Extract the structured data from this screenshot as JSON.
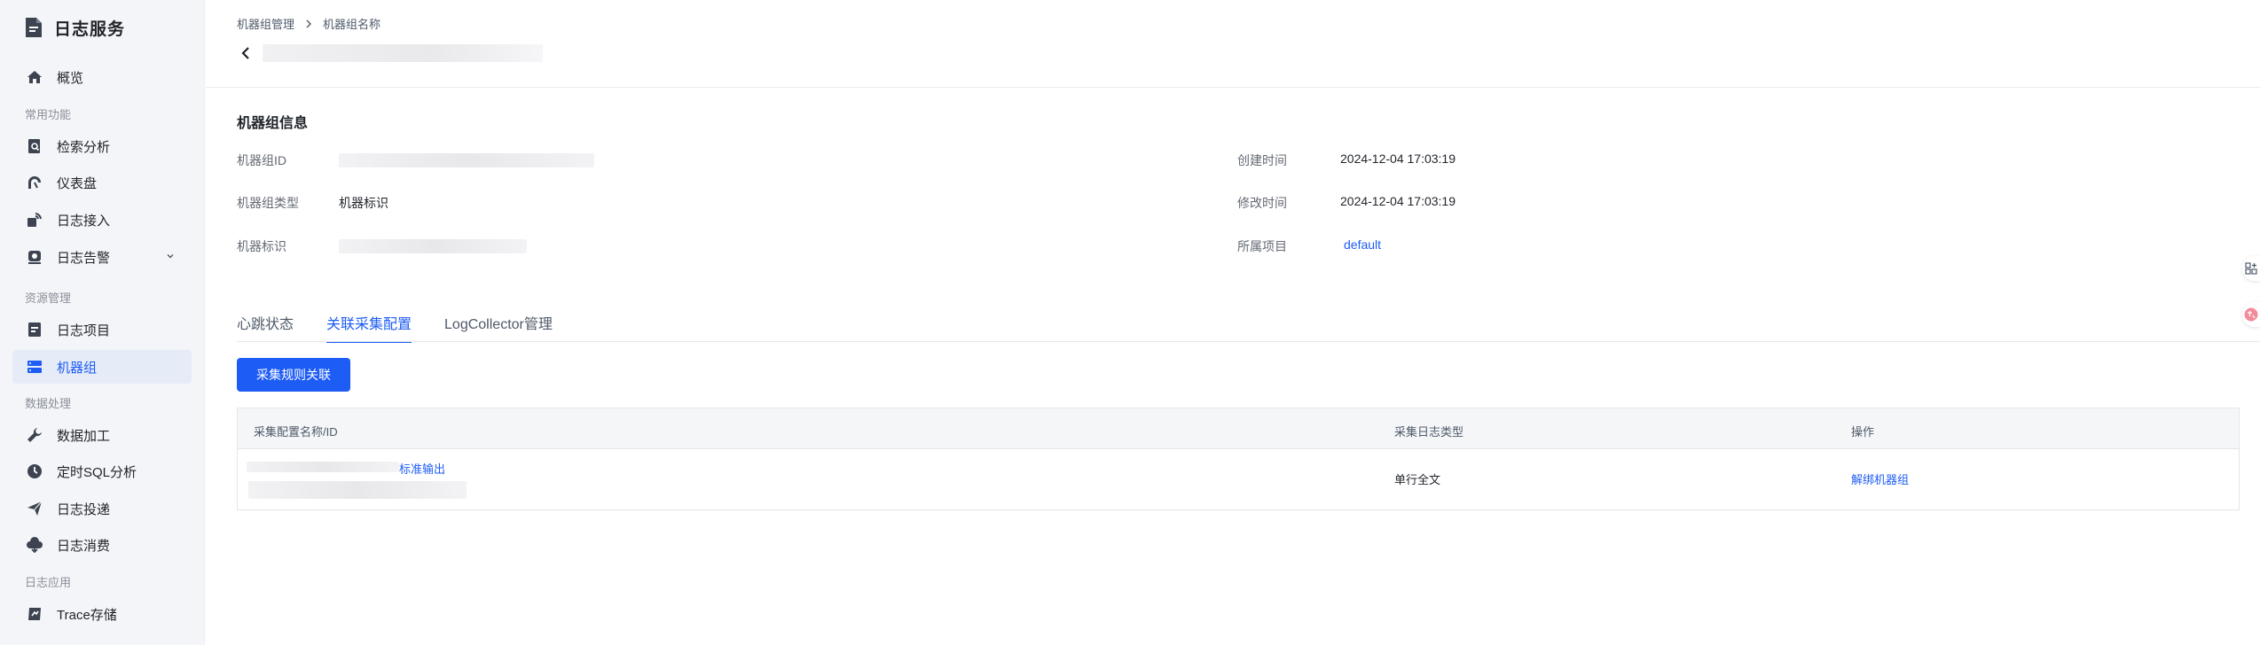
{
  "app": {
    "title": "日志服务"
  },
  "sidebar": {
    "overview": {
      "label": "概览",
      "icon": "home-icon"
    },
    "sections": {
      "common": "常用功能",
      "resources": "资源管理",
      "data_processing": "数据处理",
      "log_apps": "日志应用"
    },
    "common_items": [
      {
        "label": "检索分析",
        "icon": "search-document-icon"
      },
      {
        "label": "仪表盘",
        "icon": "dashboard-icon"
      },
      {
        "label": "日志接入",
        "icon": "log-ingest-icon"
      },
      {
        "label": "日志告警",
        "icon": "alarm-icon",
        "has_submenu": true
      }
    ],
    "resource_items": [
      {
        "label": "日志项目",
        "icon": "project-icon"
      },
      {
        "label": "机器组",
        "icon": "server-group-icon",
        "active": true
      }
    ],
    "processing_items": [
      {
        "label": "数据加工",
        "icon": "wrench-icon"
      },
      {
        "label": "定时SQL分析",
        "icon": "clock-icon"
      },
      {
        "label": "日志投递",
        "icon": "send-icon"
      },
      {
        "label": "日志消费",
        "icon": "cloud-icon"
      }
    ],
    "app_items": [
      {
        "label": "Trace存储",
        "icon": "trace-icon"
      }
    ]
  },
  "breadcrumb": {
    "parent": "机器组管理",
    "current": "机器组名称"
  },
  "info": {
    "title": "机器组信息",
    "id_label": "机器组ID",
    "type_label": "机器组类型",
    "type_value": "机器标识",
    "identifier_label": "机器标识",
    "created_label": "创建时间",
    "created_value": "2024-12-04 17:03:19",
    "modified_label": "修改时间",
    "modified_value": "2024-12-04 17:03:19",
    "project_label": "所属项目",
    "project_value": "default"
  },
  "tabs": [
    {
      "label": "心跳状态",
      "active": false
    },
    {
      "label": "关联采集配置",
      "active": true
    },
    {
      "label": "LogCollector管理",
      "active": false
    }
  ],
  "actions": {
    "bind_rule": "采集规则关联"
  },
  "table": {
    "headers": {
      "name": "采集配置名称/ID",
      "log_type": "采集日志类型",
      "ops": "操作"
    },
    "rows": [
      {
        "name_suffix": "标准输出",
        "log_type": "单行全文",
        "op": "解绑机器组"
      }
    ]
  },
  "colors": {
    "primary": "#1d5cf5",
    "sidebar_bg": "#f4f5f8",
    "active_bg": "#e6ebf8"
  }
}
